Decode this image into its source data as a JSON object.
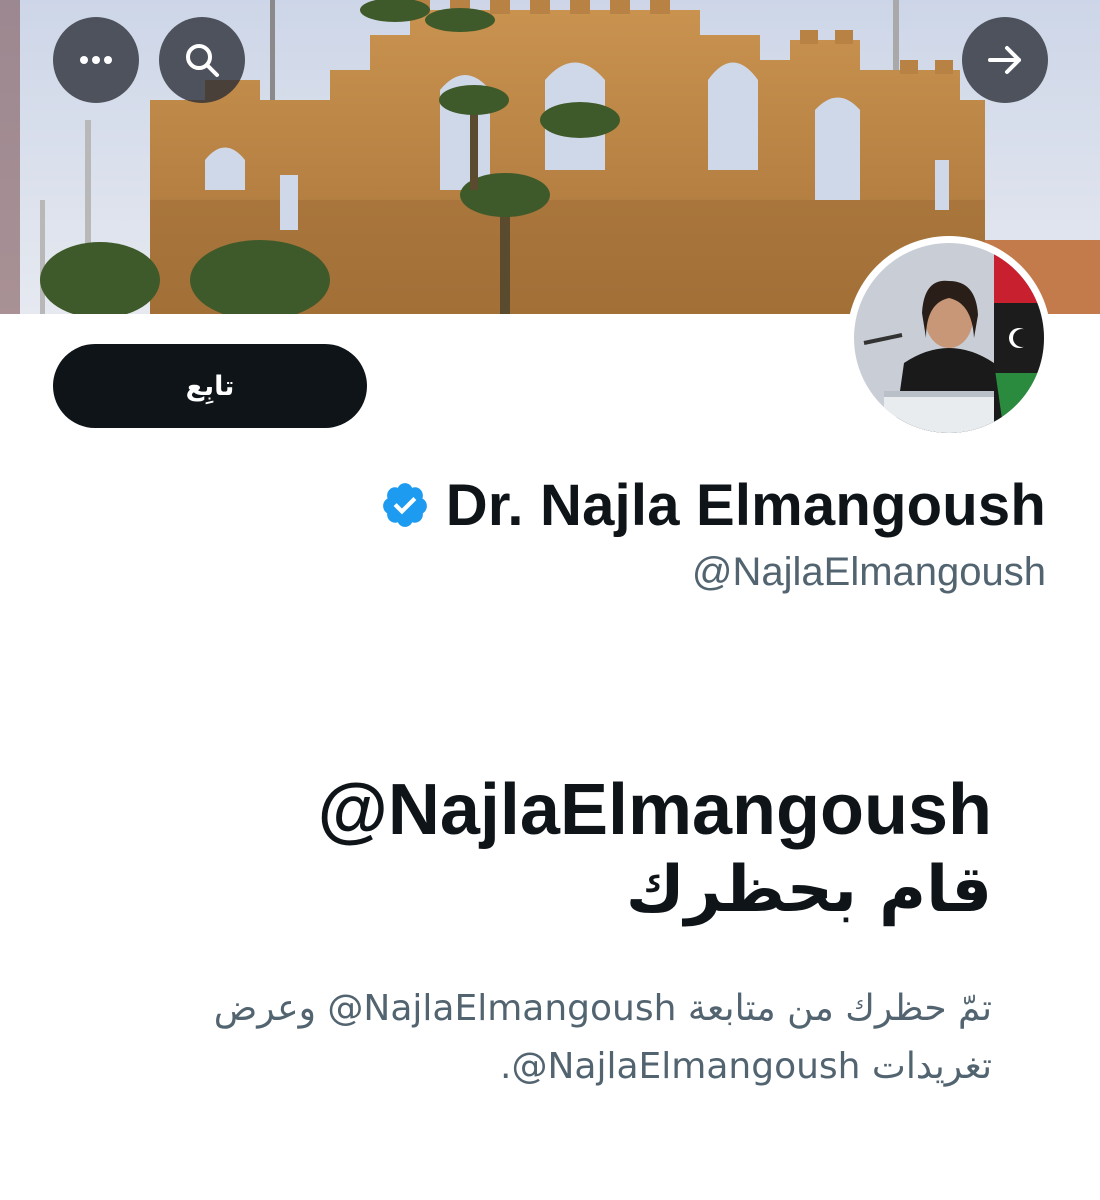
{
  "header": {
    "more_icon": "more-horizontal-icon",
    "search_icon": "search-icon",
    "back_icon": "arrow-right-icon"
  },
  "profile": {
    "display_name": "Dr. Najla Elmangoush",
    "handle": "@NajlaElmangoush",
    "verified_icon": "verified-badge-icon",
    "verified_color": "#1d9bf0"
  },
  "actions": {
    "follow_label": "تابِع"
  },
  "blocked_notice": {
    "title_line1": "@NajlaElmangoush",
    "title_line2": "قام بحظرك",
    "description": "تمّ حظرك من متابعة NajlaElmangoush@ وعرض تغريدات NajlaElmangoush@."
  },
  "colors": {
    "primary_text": "#0f1419",
    "secondary_text": "#536471",
    "button_bg": "#0f1419",
    "button_text": "#ffffff"
  }
}
